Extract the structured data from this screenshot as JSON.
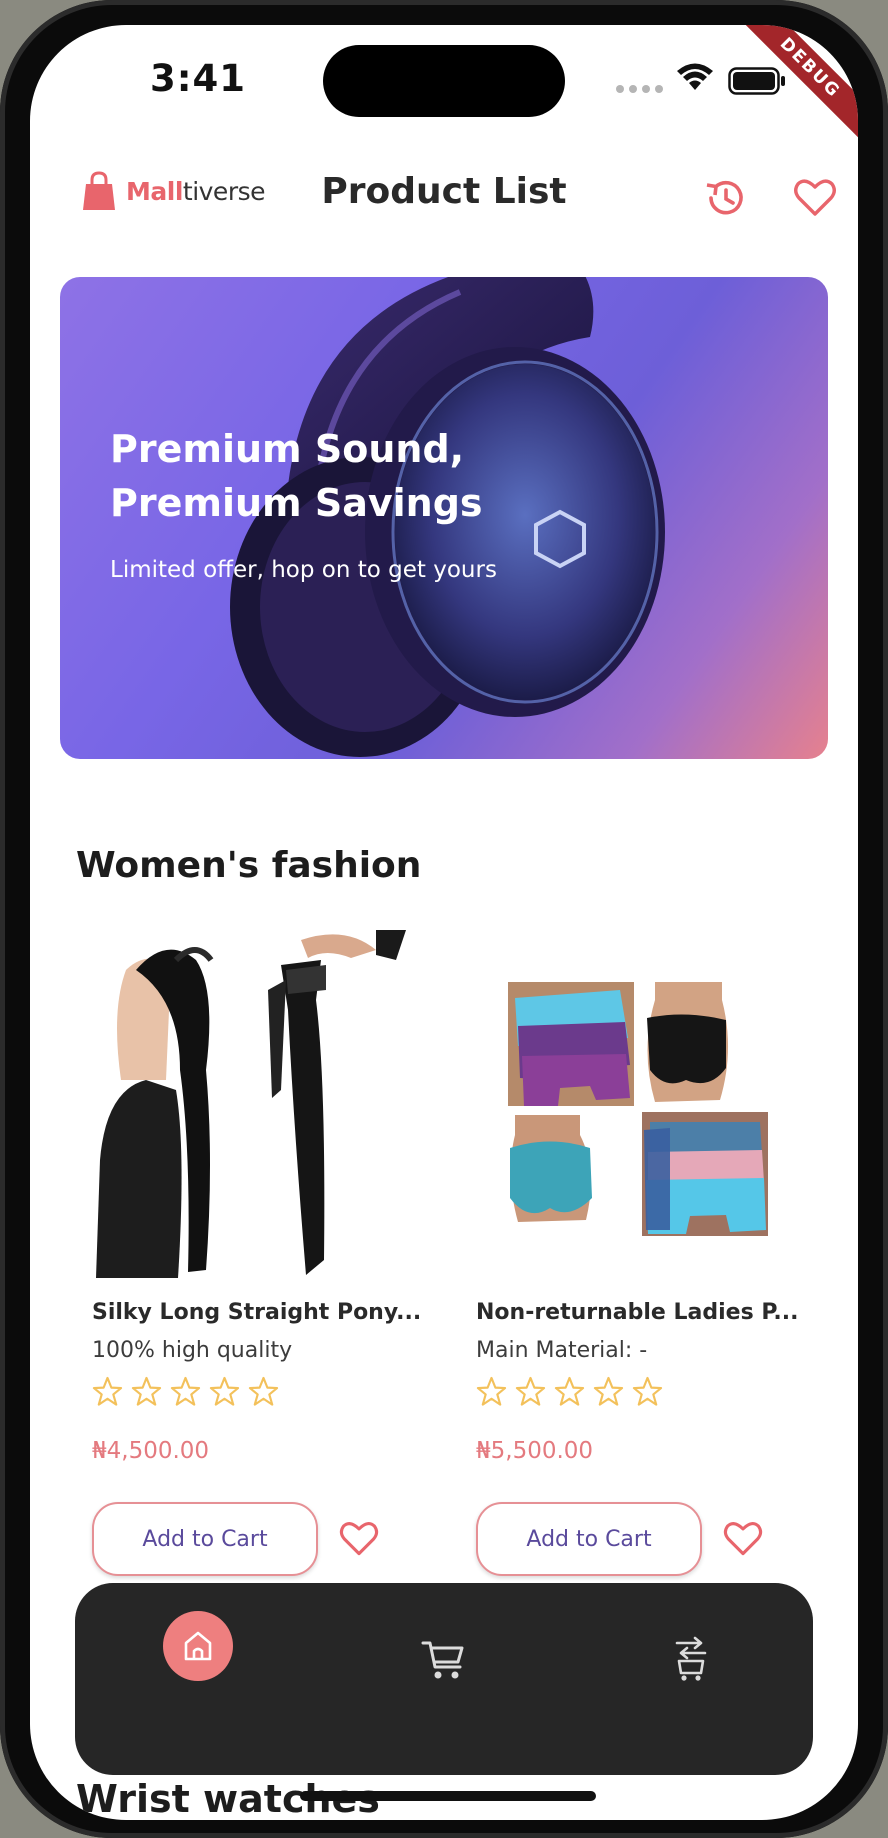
{
  "status_bar": {
    "time": "3:41",
    "debug_label": "DEBUG"
  },
  "header": {
    "logo_accent": "Mall",
    "logo_rest": "tiverse",
    "title": "Product List"
  },
  "banner": {
    "title": "Premium Sound,\nPremium Savings",
    "subtitle": "Limited offer, hop on to get yours"
  },
  "section": {
    "title": "Women's fashion",
    "products": [
      {
        "name": "Silky Long Straight Pony...",
        "description": "100% high quality",
        "rating": 0,
        "max_rating": 5,
        "price": "₦4,500.00",
        "cta": "Add to Cart"
      },
      {
        "name": "Non-returnable Ladies P...",
        "description": "Main Material: -",
        "rating": 0,
        "max_rating": 5,
        "price": "₦5,500.00",
        "cta": "Add to Cart"
      }
    ]
  },
  "next_section": {
    "title": "Wrist watches"
  },
  "bottom_nav": {
    "items": [
      {
        "icon": "home-icon",
        "active": true
      },
      {
        "icon": "cart-icon",
        "active": false
      },
      {
        "icon": "orders-icon",
        "active": false
      }
    ]
  },
  "colors": {
    "accent": "#e8656c",
    "price": "#e47a7f",
    "star": "#f3c15b",
    "nav_bg": "#262626",
    "nav_active": "#ee7f7f",
    "button_text": "#5a4a9c"
  }
}
